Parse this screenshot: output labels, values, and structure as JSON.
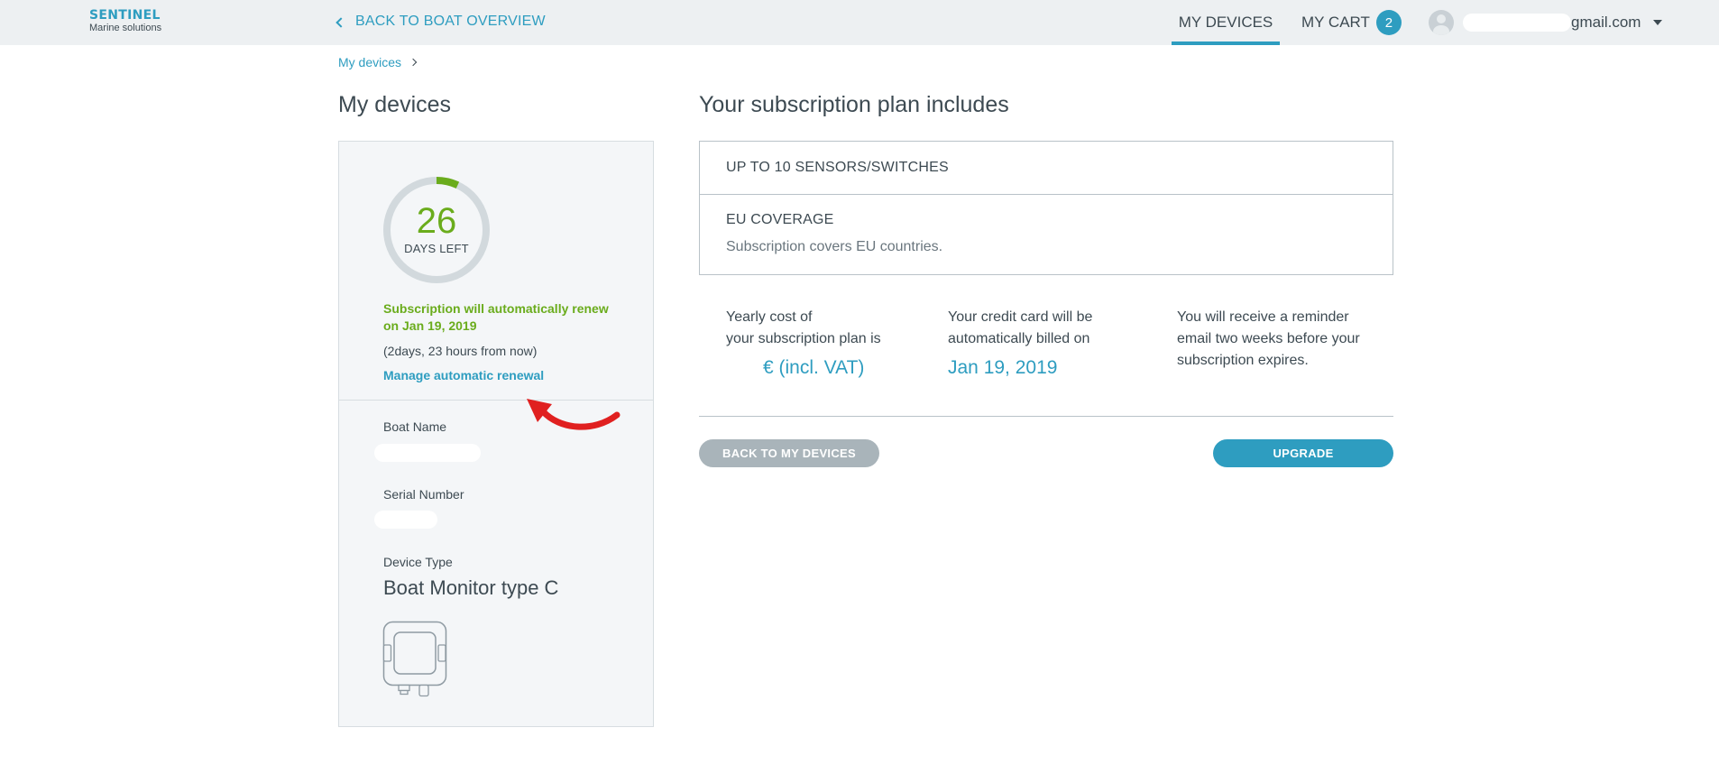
{
  "header": {
    "logo_title": "SENTINEL",
    "logo_sub": "Marine solutions",
    "back_link": "BACK TO BOAT OVERVIEW",
    "nav_my_devices": "MY DEVICES",
    "nav_my_cart": "MY CART",
    "cart_count": "2",
    "user_email_visible": "gmail.com"
  },
  "breadcrumb": {
    "item": "My devices"
  },
  "left": {
    "title": "My devices",
    "days_left_number": "26",
    "days_left_label": "DAYS LEFT",
    "renew_text": "Subscription will automatically renew on Jan 19, 2019",
    "renew_when": "(2days, 23 hours from now)",
    "manage_link": "Manage automatic renewal",
    "boat_name_label": "Boat Name",
    "serial_number_label": "Serial Number",
    "device_type_label": "Device Type",
    "device_type_value": "Boat Monitor type C"
  },
  "plan": {
    "title": "Your subscription plan includes",
    "rows": [
      {
        "head": "UP TO 10 SENSORS/SWITCHES",
        "desc": ""
      },
      {
        "head": "EU COVERAGE",
        "desc": "Subscription covers EU countries."
      }
    ]
  },
  "info": {
    "cost_line1": "Yearly cost of",
    "cost_line2": "your subscription plan is",
    "cost_value": "€ (incl. VAT)",
    "billed_line1": "Your credit card will be",
    "billed_line2": "automatically billed on",
    "billed_value": "Jan 19, 2019",
    "reminder_line1": "You will receive a reminder",
    "reminder_line2": "email two weeks before your",
    "reminder_line3": "subscription expires."
  },
  "actions": {
    "back_label": "BACK TO MY DEVICES",
    "upgrade_label": "UPGRADE"
  },
  "colors": {
    "accent": "#2e9dc0",
    "green": "#6aac1c",
    "annotation_arrow": "#e02020"
  },
  "days_ring_progress": 0.07
}
